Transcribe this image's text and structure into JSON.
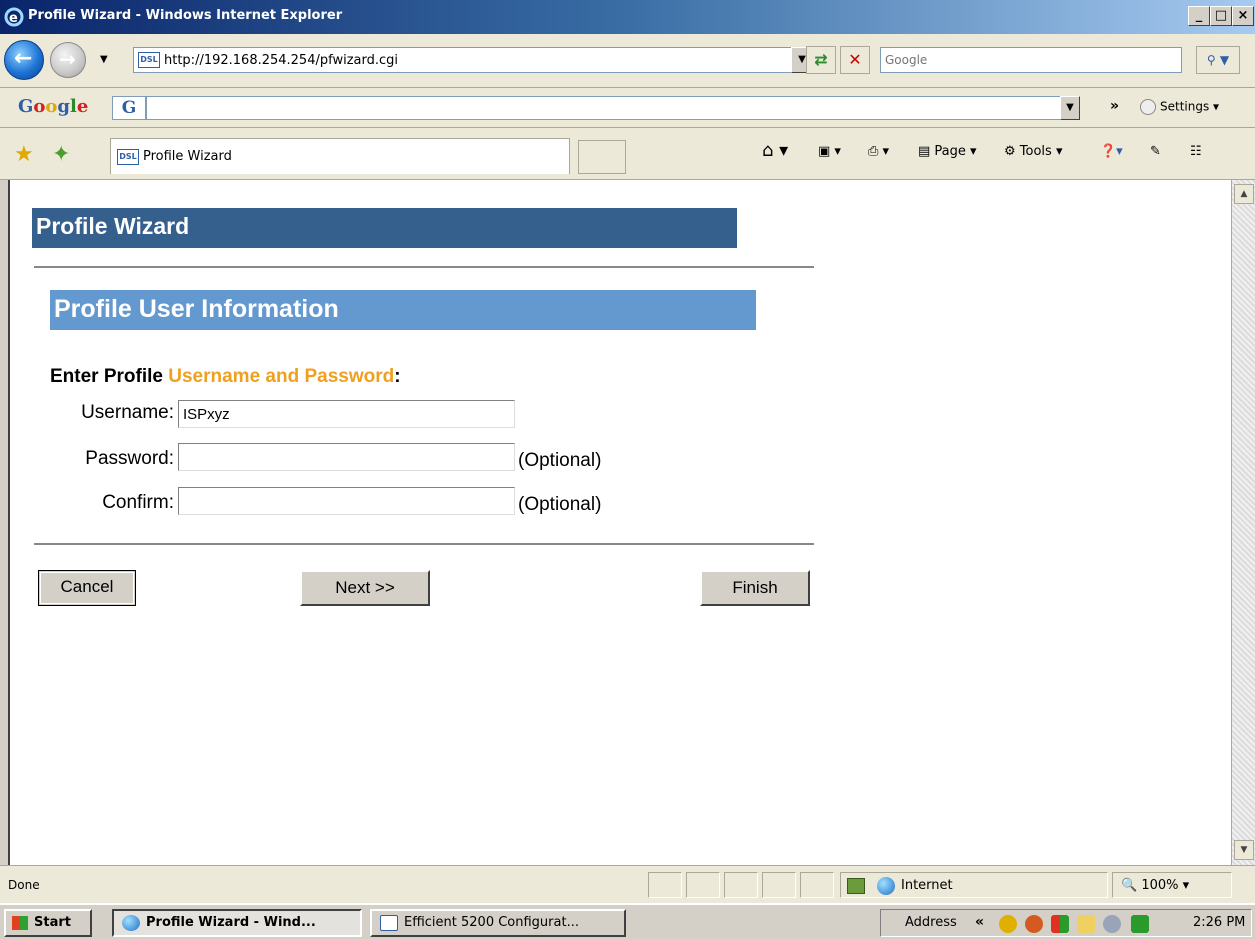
{
  "window": {
    "title": "Profile Wizard - Windows Internet Explorer"
  },
  "address_bar": {
    "url": "http://192.168.254.254/pfwizard.cgi",
    "site_icon": "DSL"
  },
  "search": {
    "placeholder": "Google"
  },
  "google_toolbar": {
    "logo": "Google",
    "button": "G",
    "settings": "Settings"
  },
  "tab": {
    "title": "Profile Wizard"
  },
  "command_bar": {
    "page_label": "Page",
    "tools_label": "Tools"
  },
  "page": {
    "wizard_title": "Profile Wizard",
    "section_title": "Profile User Information",
    "prompt_prefix": "Enter Profile ",
    "prompt_highlight": "Username and Password",
    "prompt_suffix": ":",
    "fields": {
      "username_label": "Username:",
      "username_value": "ISPxyz",
      "password_label": "Password:",
      "password_value": "",
      "confirm_label": "Confirm:",
      "confirm_value": "",
      "optional": "(Optional)"
    },
    "buttons": {
      "cancel": "Cancel",
      "next": "Next >>",
      "finish": "Finish"
    }
  },
  "status_bar": {
    "status": "Done",
    "zone": "Internet",
    "zoom": "100%"
  },
  "taskbar": {
    "start": "Start",
    "tasks": [
      "Profile Wizard - Wind...",
      "Efficient 5200 Configurat..."
    ],
    "address_label": "Address",
    "clock": "2:26 PM"
  },
  "colors": {
    "wizard_banner": "#35608e",
    "section_banner": "#6499cf",
    "highlight_orange": "#f0a020"
  }
}
